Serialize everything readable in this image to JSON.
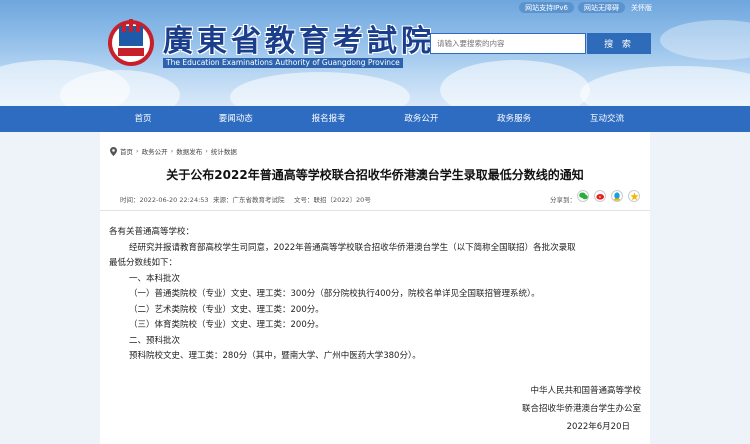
{
  "header": {
    "top_links": [
      "网站支持IPv6",
      "网站无障碍",
      "关怀版"
    ],
    "site_title": "廣東省教育考試院",
    "site_subtitle": "The Education Examinations Authority of Guangdong Province",
    "search": {
      "placeholder": "请输入要搜索的内容",
      "button_label": "搜 索"
    }
  },
  "nav": {
    "items": [
      "首页",
      "要闻动态",
      "报名报考",
      "政务公开",
      "政务服务",
      "互动交流"
    ]
  },
  "breadcrumb": [
    "首页",
    "政务公开",
    "数据发布",
    "统计数据"
  ],
  "article": {
    "title": "关于公布2022年普通高等学校联合招收华侨港澳台学生录取最低分数线的通知",
    "meta": {
      "time": "时间：2022-06-20 22:24:53",
      "source": "来源：广东省教育考试院",
      "doc_no": "文号：联招〔2022〕20号",
      "share_label": "分享到："
    },
    "paragraphs": [
      "各有关普通高等学校：",
      "经研究并报请教育部高校学生司同意，2022年普通高等学校联合招收华侨港澳台学生（以下简称全国联招）各批次录取",
      "最低分数线如下：",
      "一、本科批次",
      "（一）普通类院校（专业）文史、理工类：300分（部分院校执行400分，院校名单详见全国联招管理系统）。",
      "（二）艺术类院校（专业）文史、理工类：200分。",
      "（三）体育类院校（专业）文史、理工类：200分。",
      "二、预科批次",
      "预科院校文史、理工类：280分（其中，暨南大学、广州中医药大学380分）。"
    ],
    "signature": {
      "line1": "中华人民共和国普通高等学校",
      "line2": "联合招收华侨港澳台学生办公室",
      "date": "2022年6月20日"
    }
  },
  "colors": {
    "nav_bg": "#2e6cc1",
    "title_blue": "#1a3e8c",
    "logo_red": "#c8202a"
  },
  "icons": [
    "location-icon",
    "wechat-icon",
    "weibo-icon",
    "qq-icon",
    "qzone-icon"
  ]
}
